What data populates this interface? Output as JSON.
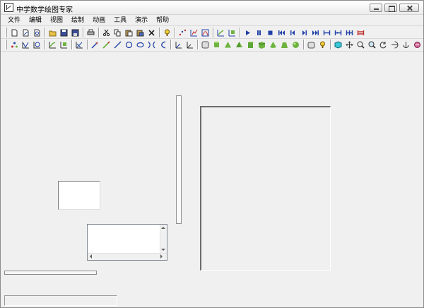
{
  "window": {
    "title": "中学数学绘图专家"
  },
  "menubar": {
    "items": [
      {
        "label": "文件"
      },
      {
        "label": "编辑"
      },
      {
        "label": "视图"
      },
      {
        "label": "绘制"
      },
      {
        "label": "动画"
      },
      {
        "label": "工具"
      },
      {
        "label": "演示"
      },
      {
        "label": "帮助"
      }
    ]
  },
  "toolbar1": [
    "new-file",
    "new-2d",
    "new-3d",
    "|",
    "open-folder",
    "save",
    "save-as",
    "|",
    "print",
    "|",
    "cut",
    "copy",
    "paste",
    "paste-special",
    "delete",
    "|",
    "help",
    "|",
    "scatter-points",
    "axes-grid",
    "axes-curve",
    "|",
    "plot-function",
    "plot-parametric",
    "|",
    "play",
    "pause",
    "stop",
    "to-start",
    "step-back",
    "step-forward",
    "to-end",
    "step-lines-1",
    "step-lines-2",
    "step-lines-3",
    "step-lines-4"
  ],
  "toolbar2": [
    "points",
    "func-curve",
    "func-area",
    "|",
    "insert-function",
    "insert-parametric",
    "|",
    "coord-system",
    "|",
    "line-arrow",
    "curve-pen",
    "segment",
    "circle",
    "ellipse",
    "hyperbola",
    "parabola",
    "|",
    "axis-xy",
    "axis-xyz",
    "|",
    "eraser",
    "cylinder",
    "cone",
    "pyramid",
    "prism",
    "cube-solid",
    "tetrahedron",
    "frustum",
    "sphere",
    "|",
    "wireframe",
    "light-bulb",
    "|",
    "cube-3d",
    "move",
    "zoom-in",
    "zoom-out",
    "rotate-x",
    "rotate-y",
    "rotate-z",
    "rotate-free"
  ],
  "colors": {
    "toolbar_blue": "#1f3fa6",
    "icon_green": "#6db33f",
    "icon_red": "#c03030",
    "panel_gray": "#f0f0f0"
  },
  "status": {
    "text": ""
  }
}
